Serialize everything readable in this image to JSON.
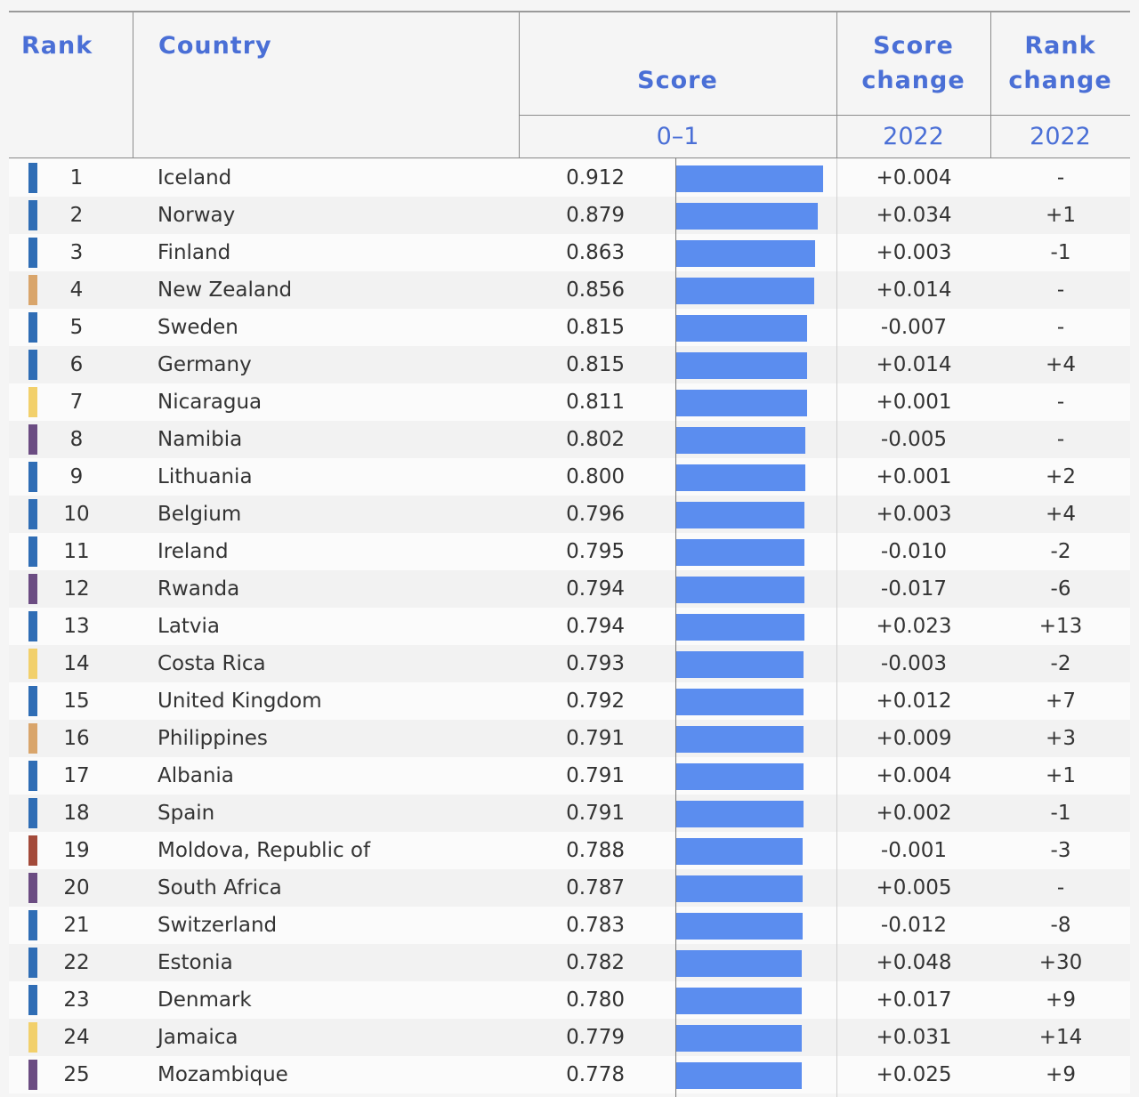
{
  "header": {
    "rank": "Rank",
    "country": "Country",
    "score": "Score",
    "score_range": "0–1",
    "score_change_line1": "Score",
    "score_change_line2": "change",
    "score_change_year": "2022",
    "rank_change_line1": "Rank",
    "rank_change_line2": "change",
    "rank_change_year": "2022"
  },
  "colors": {
    "bar": "#5b8def",
    "header_text": "#4a6fd6",
    "Europe": "#2f6db5",
    "East Asia and the Pacific": "#d9a56b",
    "Latin America and the Caribbean": "#f2d06b",
    "Sub-Saharan Africa": "#6b4c82",
    "Eurasia and Central Asia": "#a34a3a"
  },
  "chart_data": {
    "type": "table",
    "score_axis": [
      0,
      1
    ],
    "rows": [
      {
        "rank": "1",
        "country": "Iceland",
        "score": 0.912,
        "score_label": "0.912",
        "score_change": "+0.004",
        "rank_change": "-",
        "swatch": "#2f6db5"
      },
      {
        "rank": "2",
        "country": "Norway",
        "score": 0.879,
        "score_label": "0.879",
        "score_change": "+0.034",
        "rank_change": "+1",
        "swatch": "#2f6db5"
      },
      {
        "rank": "3",
        "country": "Finland",
        "score": 0.863,
        "score_label": "0.863",
        "score_change": "+0.003",
        "rank_change": "-1",
        "swatch": "#2f6db5"
      },
      {
        "rank": "4",
        "country": "New Zealand",
        "score": 0.856,
        "score_label": "0.856",
        "score_change": "+0.014",
        "rank_change": "-",
        "swatch": "#d9a56b"
      },
      {
        "rank": "5",
        "country": "Sweden",
        "score": 0.815,
        "score_label": "0.815",
        "score_change": "-0.007",
        "rank_change": "-",
        "swatch": "#2f6db5"
      },
      {
        "rank": "6",
        "country": "Germany",
        "score": 0.815,
        "score_label": "0.815",
        "score_change": "+0.014",
        "rank_change": "+4",
        "swatch": "#2f6db5"
      },
      {
        "rank": "7",
        "country": "Nicaragua",
        "score": 0.811,
        "score_label": "0.811",
        "score_change": "+0.001",
        "rank_change": "-",
        "swatch": "#f2d06b"
      },
      {
        "rank": "8",
        "country": "Namibia",
        "score": 0.802,
        "score_label": "0.802",
        "score_change": "-0.005",
        "rank_change": "-",
        "swatch": "#6b4c82"
      },
      {
        "rank": "9",
        "country": "Lithuania",
        "score": 0.8,
        "score_label": "0.800",
        "score_change": "+0.001",
        "rank_change": "+2",
        "swatch": "#2f6db5"
      },
      {
        "rank": "10",
        "country": "Belgium",
        "score": 0.796,
        "score_label": "0.796",
        "score_change": "+0.003",
        "rank_change": "+4",
        "swatch": "#2f6db5"
      },
      {
        "rank": "11",
        "country": "Ireland",
        "score": 0.795,
        "score_label": "0.795",
        "score_change": "-0.010",
        "rank_change": "-2",
        "swatch": "#2f6db5"
      },
      {
        "rank": "12",
        "country": "Rwanda",
        "score": 0.794,
        "score_label": "0.794",
        "score_change": "-0.017",
        "rank_change": "-6",
        "swatch": "#6b4c82"
      },
      {
        "rank": "13",
        "country": "Latvia",
        "score": 0.794,
        "score_label": "0.794",
        "score_change": "+0.023",
        "rank_change": "+13",
        "swatch": "#2f6db5"
      },
      {
        "rank": "14",
        "country": "Costa Rica",
        "score": 0.793,
        "score_label": "0.793",
        "score_change": "-0.003",
        "rank_change": "-2",
        "swatch": "#f2d06b"
      },
      {
        "rank": "15",
        "country": "United Kingdom",
        "score": 0.792,
        "score_label": "0.792",
        "score_change": "+0.012",
        "rank_change": "+7",
        "swatch": "#2f6db5"
      },
      {
        "rank": "16",
        "country": "Philippines",
        "score": 0.791,
        "score_label": "0.791",
        "score_change": "+0.009",
        "rank_change": "+3",
        "swatch": "#d9a56b"
      },
      {
        "rank": "17",
        "country": "Albania",
        "score": 0.791,
        "score_label": "0.791",
        "score_change": "+0.004",
        "rank_change": "+1",
        "swatch": "#2f6db5"
      },
      {
        "rank": "18",
        "country": "Spain",
        "score": 0.791,
        "score_label": "0.791",
        "score_change": "+0.002",
        "rank_change": "-1",
        "swatch": "#2f6db5"
      },
      {
        "rank": "19",
        "country": "Moldova, Republic of",
        "score": 0.788,
        "score_label": "0.788",
        "score_change": "-0.001",
        "rank_change": "-3",
        "swatch": "#a34a3a"
      },
      {
        "rank": "20",
        "country": "South Africa",
        "score": 0.787,
        "score_label": "0.787",
        "score_change": "+0.005",
        "rank_change": "-",
        "swatch": "#6b4c82"
      },
      {
        "rank": "21",
        "country": "Switzerland",
        "score": 0.783,
        "score_label": "0.783",
        "score_change": "-0.012",
        "rank_change": "-8",
        "swatch": "#2f6db5"
      },
      {
        "rank": "22",
        "country": "Estonia",
        "score": 0.782,
        "score_label": "0.782",
        "score_change": "+0.048",
        "rank_change": "+30",
        "swatch": "#2f6db5"
      },
      {
        "rank": "23",
        "country": "Denmark",
        "score": 0.78,
        "score_label": "0.780",
        "score_change": "+0.017",
        "rank_change": "+9",
        "swatch": "#2f6db5"
      },
      {
        "rank": "24",
        "country": "Jamaica",
        "score": 0.779,
        "score_label": "0.779",
        "score_change": "+0.031",
        "rank_change": "+14",
        "swatch": "#f2d06b"
      },
      {
        "rank": "25",
        "country": "Mozambique",
        "score": 0.778,
        "score_label": "0.778",
        "score_change": "+0.025",
        "rank_change": "+9",
        "swatch": "#6b4c82"
      }
    ]
  }
}
